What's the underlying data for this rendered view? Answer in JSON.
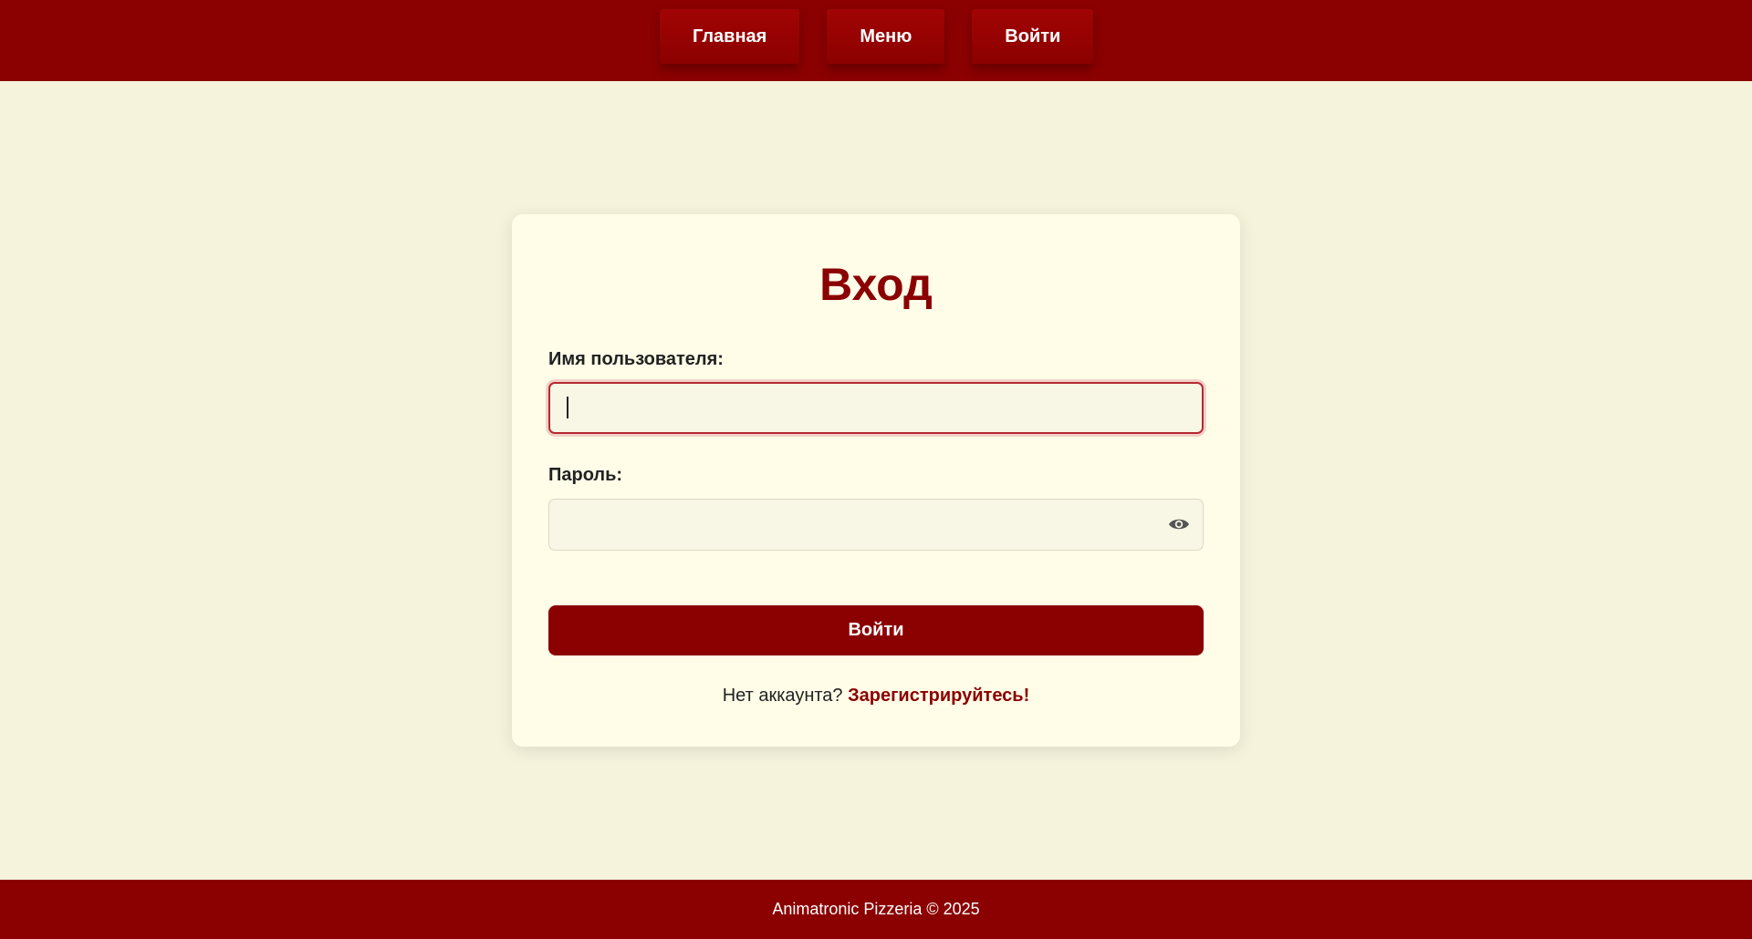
{
  "nav": {
    "items": [
      {
        "label": "Главная"
      },
      {
        "label": "Меню"
      },
      {
        "label": "Войти"
      }
    ]
  },
  "login": {
    "title": "Вход",
    "username_label": "Имя пользователя:",
    "username_value": "",
    "password_label": "Пароль:",
    "password_value": "",
    "password_toggle_icon": "eye-icon",
    "submit_label": "Войти",
    "register_prompt": "Нет аккаунта?",
    "register_link": "Зарегистрируйтесь!"
  },
  "footer": {
    "text": "Animatronic Pizzeria © 2025"
  },
  "colors": {
    "brand": "#8b0000",
    "background": "#f5f3dc",
    "card": "#fffde8"
  }
}
